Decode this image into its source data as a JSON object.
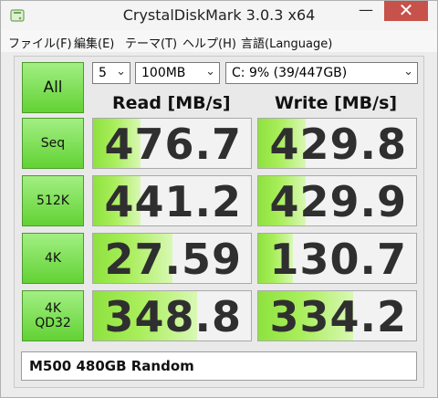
{
  "window": {
    "title": "CrystalDiskMark 3.0.3 x64",
    "minimize_glyph": "—",
    "maximize_glyph": "☐",
    "close_glyph": "✕"
  },
  "menu": [
    "ファイル(F)",
    "編集(E)",
    "テーマ(T)",
    "ヘルプ(H)",
    "言語(Language)"
  ],
  "controls": {
    "all_label": "All",
    "runs": "5",
    "size": "100MB",
    "drive": "C: 9% (39/447GB)",
    "dropdown_icon": "chevron-down-icon"
  },
  "headers": {
    "read": "Read [MB/s]",
    "write": "Write [MB/s]"
  },
  "tests": [
    {
      "label": "Seq",
      "label2": "",
      "read": "476.7",
      "write": "429.8",
      "read_fill": 0.3,
      "write_fill": 0.3
    },
    {
      "label": "512K",
      "label2": "",
      "read": "441.2",
      "write": "429.9",
      "read_fill": 0.3,
      "write_fill": 0.3
    },
    {
      "label": "4K",
      "label2": "",
      "read": "27.59",
      "write": "130.7",
      "read_fill": 0.5,
      "write_fill": 0.22
    },
    {
      "label": "4K",
      "label2": "QD32",
      "read": "348.8",
      "write": "334.2",
      "read_fill": 0.66,
      "write_fill": 0.6
    }
  ],
  "comment": "M500 480GB Random",
  "colors": {
    "accent_green": "#62d234",
    "close_red": "#c7514b"
  }
}
